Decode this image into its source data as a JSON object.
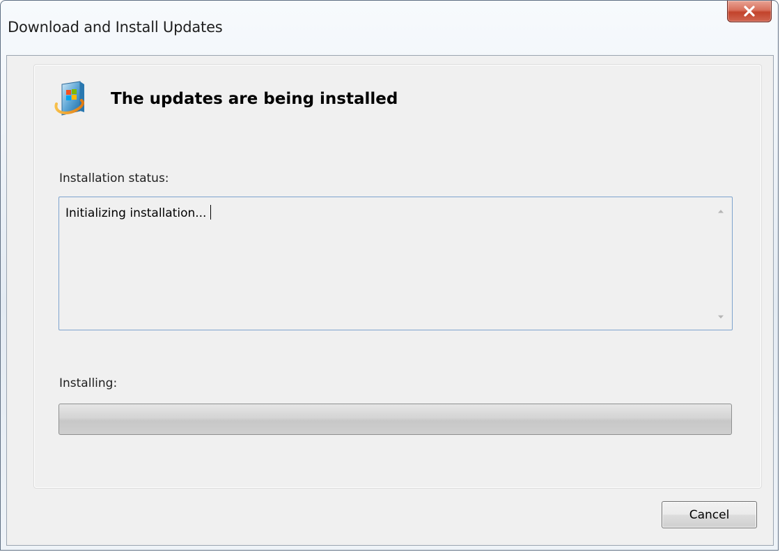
{
  "window": {
    "title": "Download and Install Updates",
    "close_icon": "close-x-icon"
  },
  "main": {
    "icon": "windows-update-icon",
    "heading": "The updates are being installed",
    "status_label": "Installation status:",
    "status_text": "Initializing installation...",
    "installing_label": "Installing:",
    "progress_percent": 0
  },
  "footer": {
    "cancel_label": "Cancel"
  },
  "colors": {
    "close_button": "#c9503a",
    "status_border": "#7da2ce",
    "panel_background": "#f0f0f0"
  }
}
